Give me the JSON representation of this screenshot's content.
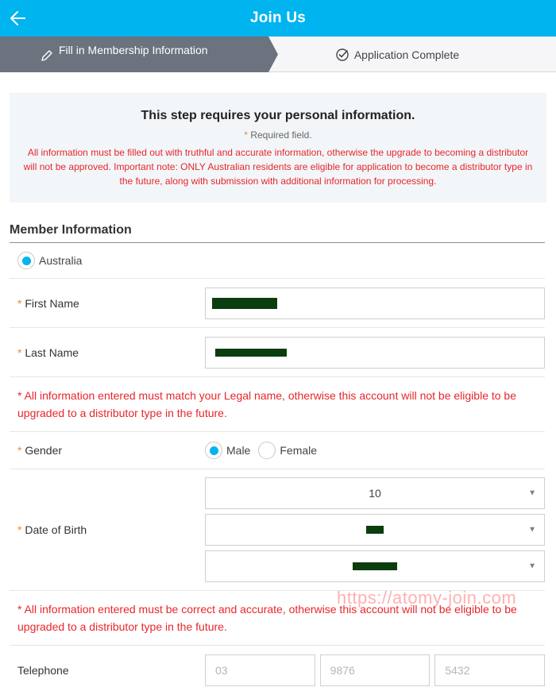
{
  "header": {
    "title": "Join Us",
    "back_icon": "arrow-left-icon"
  },
  "stepper": {
    "steps": [
      {
        "label": "Fill in Membership Information",
        "icon": "pencil-icon",
        "active": true
      },
      {
        "label": "Application Complete",
        "icon": "check-circle-icon",
        "active": false
      }
    ]
  },
  "notice": {
    "heading": "This step requires your personal information.",
    "required_star": "*",
    "required_label": "Required field.",
    "warning": "All information must be filled out with truthful and accurate information, otherwise the upgrade to becoming a distributor will not be approved. Important note: ONLY Australian residents are eligible for application to become a distributor type in the future, along with submission with additional information for processing."
  },
  "member_info": {
    "title": "Member Information",
    "country": {
      "label": "Australia",
      "selected": true
    },
    "first_name": {
      "star": "*",
      "label": "First Name",
      "value": "[redacted]"
    },
    "last_name": {
      "star": "*",
      "label": "Last Name",
      "value": "[redacted]"
    },
    "legal_name_note": "* All information entered must match your Legal name, otherwise this account will not be eligible to be upgraded to a distributor type in the future.",
    "gender": {
      "star": "*",
      "label": "Gender",
      "options": [
        {
          "label": "Male",
          "selected": true
        },
        {
          "label": "Female",
          "selected": false
        }
      ]
    },
    "dob": {
      "star": "*",
      "label": "Date of Birth",
      "selects": [
        {
          "value": "10",
          "redacted": false
        },
        {
          "value": "[redacted]",
          "redacted": true
        },
        {
          "value": "[redacted]",
          "redacted": true
        }
      ],
      "arrow": "▼"
    },
    "accuracy_note": "* All information entered must be correct and accurate, otherwise this account will not be eligible to be upgraded to a distributor type in the future.",
    "telephone": {
      "label": "Telephone",
      "placeholders": [
        "03",
        "9876",
        "5432"
      ]
    }
  },
  "watermark": "https://atomy-join.com",
  "colors": {
    "brand": "#00b4f0",
    "step_active": "#6c737e",
    "warning": "#e8262b",
    "star": "#f08a24"
  }
}
